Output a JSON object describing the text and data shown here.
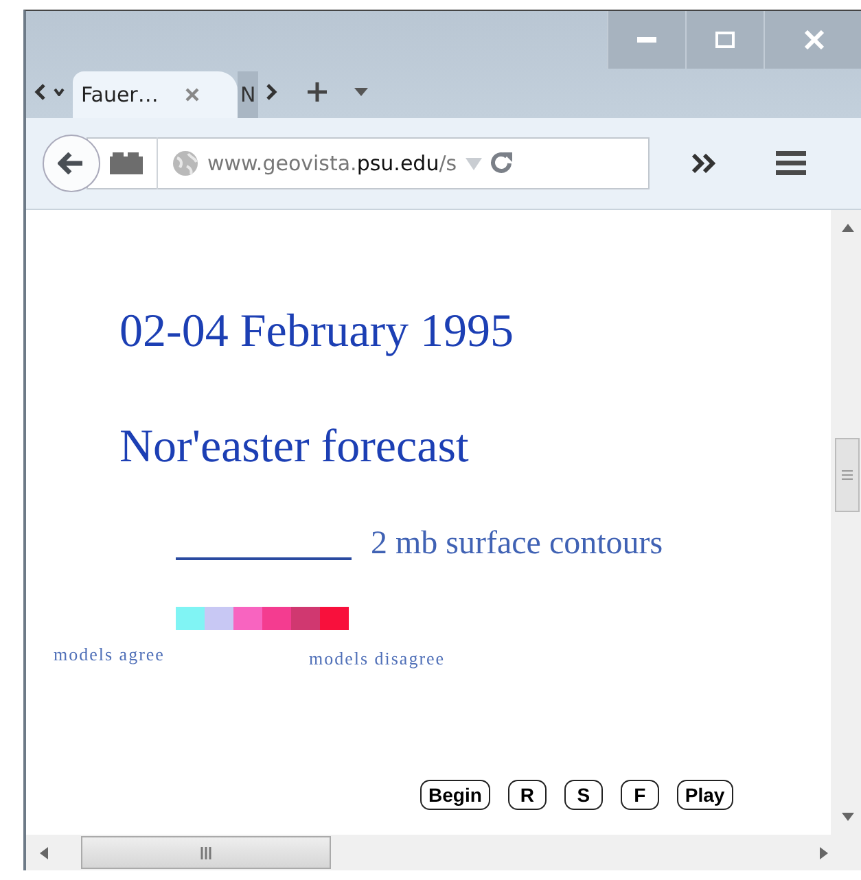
{
  "tabs": [
    {
      "label": "Fauer…",
      "selected": true
    },
    {
      "label": "N",
      "selected": false
    }
  ],
  "address_bar": {
    "url": "www.geovista.**psu.edu**/s"
  },
  "page": {
    "title": "02-04 February 1995",
    "subtitle": "Nor'easter forecast",
    "contour_legend": "2 mb surface contours",
    "agreement_scale": [
      {
        "color": "#80f4f4"
      },
      {
        "color": "#c8c8f4"
      },
      {
        "color": "#f864c0"
      },
      {
        "color": "#f43c90"
      },
      {
        "color": "#d03870"
      },
      {
        "color": "#f8103c"
      }
    ],
    "scale_low_label": "models agree",
    "scale_high_label": "models disagree",
    "buttons": [
      "Begin",
      "R",
      "S",
      "F",
      "Play"
    ]
  }
}
